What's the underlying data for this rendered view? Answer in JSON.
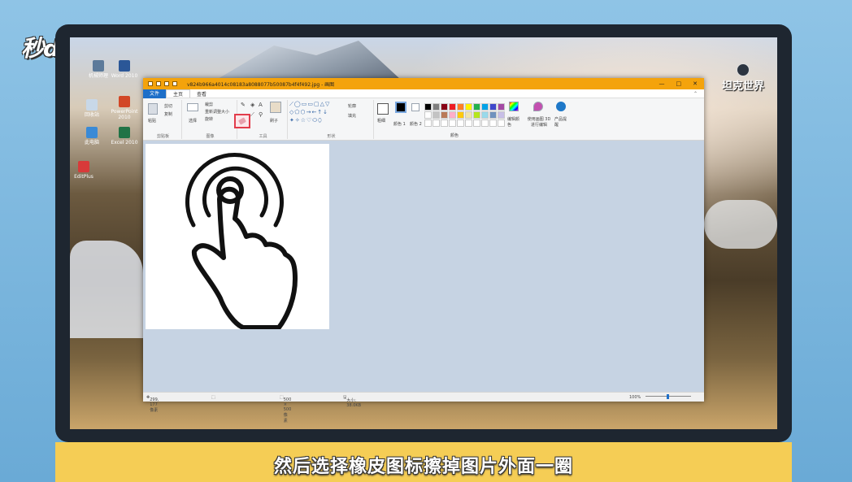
{
  "brand": {
    "logo_text": "秒dong视频"
  },
  "desktop": {
    "game_logo": "坦克世界",
    "icons": [
      {
        "label": "机械师理"
      },
      {
        "label": "回收站"
      },
      {
        "label": "此电脑"
      },
      {
        "label": "EditPlus"
      },
      {
        "label": "Word 2010"
      },
      {
        "label": "PowerPoint 2010"
      },
      {
        "label": "Excel 2010"
      }
    ]
  },
  "paint": {
    "window_title": "v824b966a4014c08183a8088077b50087b4f4f492.jpg - 画图",
    "window_controls": {
      "minimize": "—",
      "maximize": "□",
      "close": "✕"
    },
    "menu": {
      "file": "文件",
      "home": "主页",
      "view": "查看"
    },
    "ribbon": {
      "clipboard": {
        "paste": "粘贴",
        "cut": "剪切",
        "copy": "复制",
        "label": "剪贴板"
      },
      "image": {
        "select": "选择",
        "crop": "裁剪",
        "resize": "重新调整大小",
        "rotate": "旋转",
        "label": "图像"
      },
      "tools": {
        "label": "工具",
        "brushes": "刷子"
      },
      "shapes": {
        "outline": "轮廓",
        "fill": "填充",
        "label": "形状"
      },
      "size": "粗细",
      "color1": "颜色 1",
      "color2": "颜色 2",
      "colors_label": "颜色",
      "edit_colors": "编辑颜色",
      "paint3d": "使用画图 3D 进行编辑",
      "product_alert": "产品提醒"
    },
    "status": {
      "cursor": "299, 177像素",
      "dimensions": "500 × 500像素",
      "filesize": "大小: 38.0KB",
      "zoom": "100%"
    }
  },
  "palette_colors": [
    "#000000",
    "#7f7f7f",
    "#880015",
    "#ed1c24",
    "#ff7f27",
    "#fff200",
    "#22b14c",
    "#00a2e8",
    "#3f48cc",
    "#a349a4",
    "#ffffff",
    "#c3c3c3",
    "#b97a57",
    "#ffaec9",
    "#ffc90e",
    "#efe4b0",
    "#b5e61d",
    "#99d9ea",
    "#7092be",
    "#c8bfe7",
    "#ffffff",
    "#ffffff",
    "#ffffff",
    "#ffffff",
    "#ffffff",
    "#ffffff",
    "#ffffff",
    "#ffffff",
    "#ffffff",
    "#ffffff"
  ],
  "colors": {
    "accent_title": "#f4a30c",
    "file_tab": "#1e6fc8",
    "highlight": "#e23c4b",
    "subtitle_bg": "#f5cd55"
  },
  "subtitle": "然后选择橡皮图标擦掉图片外面一圈"
}
